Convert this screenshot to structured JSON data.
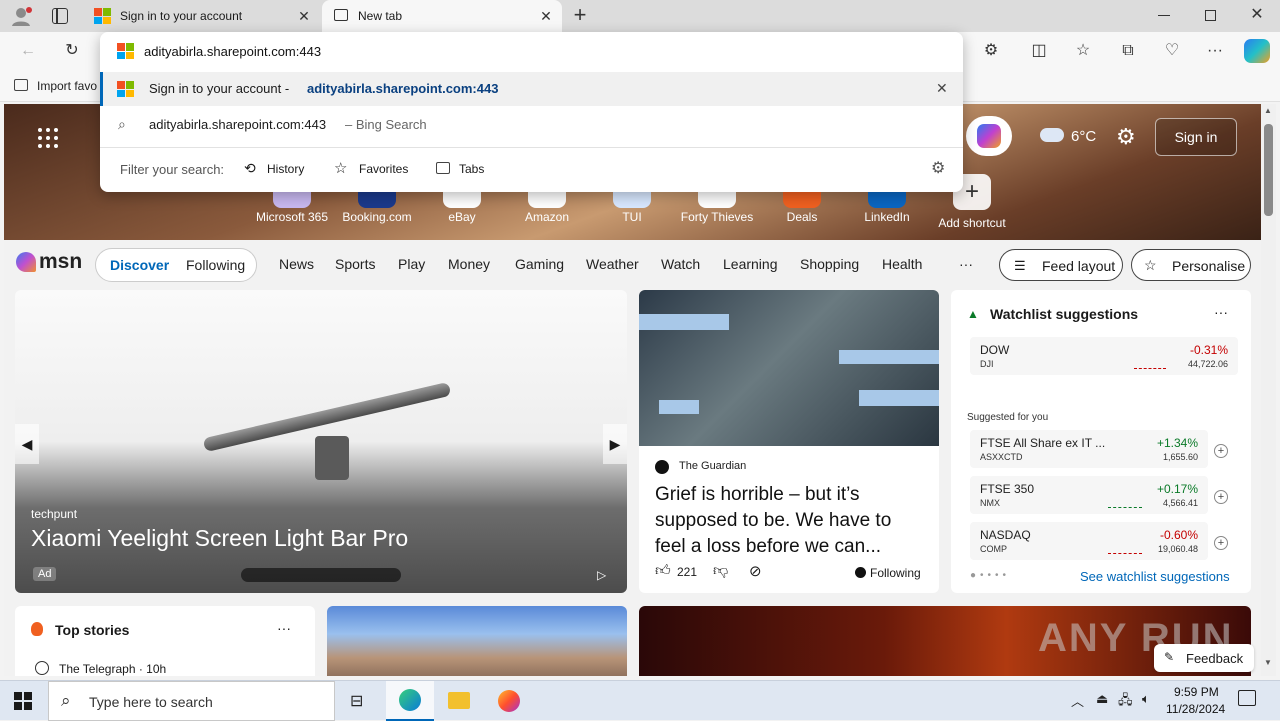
{
  "browser": {
    "tabs": [
      {
        "title": "Sign in to your account",
        "active": false
      },
      {
        "title": "New tab",
        "active": true
      }
    ],
    "address_value": "adityabirla.sharepoint.com:443",
    "favorites_bar_text": "Import favo"
  },
  "address_dropdown": {
    "suggestion1_prefix": "Sign in to your account - ",
    "suggestion1_url": "adityabirla.sharepoint.com:443",
    "suggestion2_query": "adityabirla.sharepoint.com:443",
    "suggestion2_suffix": "– Bing Search",
    "filter_label": "Filter your search:",
    "filters": [
      "History",
      "Favorites",
      "Tabs"
    ]
  },
  "hero": {
    "weather_temp": "6°C",
    "signin_label": "Sign in",
    "shortcuts": [
      "Microsoft 365",
      "Booking.com",
      "eBay",
      "Amazon",
      "TUI",
      "Forty Thieves",
      "Deals",
      "LinkedIn",
      "Add shortcut"
    ]
  },
  "msn": {
    "logo": "msn",
    "pill_tabs": [
      "Discover",
      "Following"
    ],
    "nav": [
      "News",
      "Sports",
      "Play",
      "Money",
      "Gaming",
      "Weather",
      "Watch",
      "Learning",
      "Shopping",
      "Health"
    ],
    "more": "···",
    "feed_layout": "Feed layout",
    "personalise": "Personalise"
  },
  "ad_card": {
    "source": "techpunt",
    "title": "Xiaomi Yeelight Screen Light Bar Pro",
    "badge": "Ad"
  },
  "news_card": {
    "source": "The Guardian",
    "title": "Grief is horrible – but it’s supposed to be. We have to feel a loss before we can...",
    "likes": "221",
    "following": "Following"
  },
  "watchlist": {
    "title": "Watchlist suggestions",
    "suggested_label": "Suggested for you",
    "see_more": "See watchlist suggestions",
    "stocks": [
      {
        "name": "DOW",
        "symbol": "DJI",
        "change": "-0.31%",
        "value": "44,722.06",
        "dir": "down"
      },
      {
        "name": "FTSE All Share ex IT ...",
        "symbol": "ASXXCTD",
        "change": "+1.34%",
        "value": "1,655.60",
        "dir": "up"
      },
      {
        "name": "FTSE 350",
        "symbol": "NMX",
        "change": "+0.17%",
        "value": "4,566.41",
        "dir": "up"
      },
      {
        "name": "NASDAQ",
        "symbol": "COMP",
        "change": "-0.60%",
        "value": "19,060.48",
        "dir": "down"
      }
    ]
  },
  "top_stories": {
    "title": "Top stories",
    "source_line": "The Telegraph · 10h"
  },
  "feedback_label": "Feedback",
  "watermark": "ANY RUN",
  "taskbar": {
    "search_placeholder": "Type here to search",
    "time": "9:59 PM",
    "date": "11/28/2024"
  },
  "colors": {
    "accent": "#0067b8",
    "up": "#0a7a28",
    "down": "#c40000"
  }
}
